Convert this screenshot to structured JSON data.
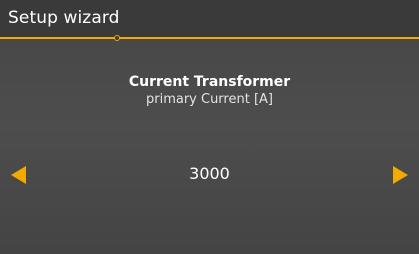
{
  "header": {
    "title": "Setup wizard",
    "progress_fraction": 0.28
  },
  "step": {
    "title": "Current Transformer",
    "subtitle": "primary Current [A]"
  },
  "value": {
    "current": "3000"
  },
  "icons": {
    "decrease": "arrow-left-icon",
    "increase": "arrow-right-icon"
  },
  "colors": {
    "accent": "#f2a900",
    "header_bg": "#3a3a3a",
    "background": "#4a4a4a",
    "text": "#ffffff"
  }
}
